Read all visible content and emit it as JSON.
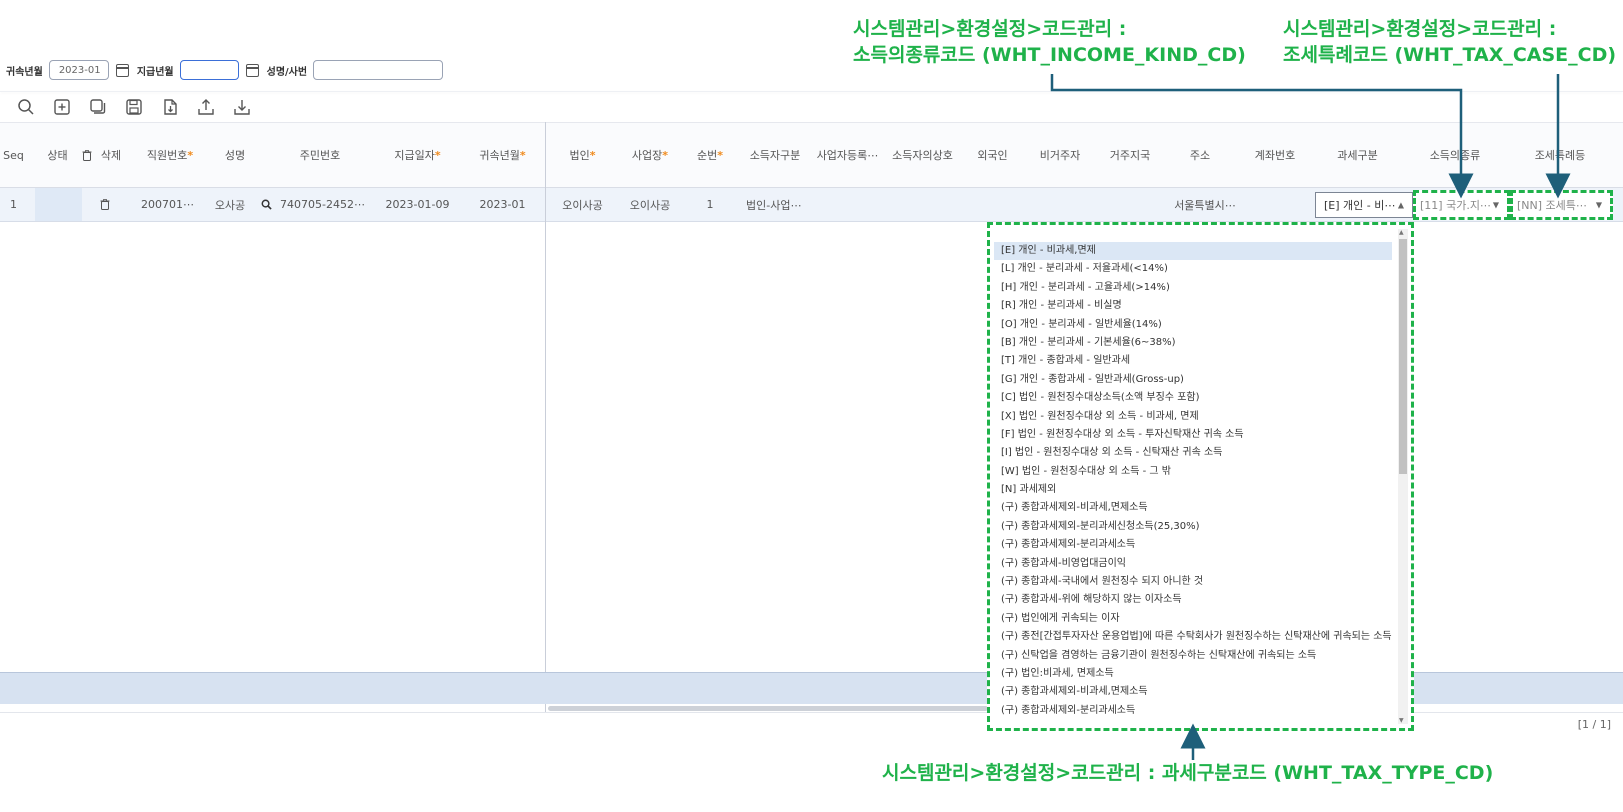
{
  "annotations": {
    "income_kind": {
      "line1": "시스템관리>환경설정>코드관리 :",
      "line2": "소득의종류코드 (WHT_INCOME_KIND_CD)"
    },
    "tax_case": {
      "line1": "시스템관리>환경설정>코드관리 :",
      "line2": "조세특례코드 (WHT_TAX_CASE_CD)"
    },
    "tax_type": {
      "text": "시스템관리>환경설정>코드관리 : 과세구분코드 (WHT_TAX_TYPE_CD)"
    }
  },
  "filters": {
    "belong_label": "귀속년월",
    "belong_value": "2023-01",
    "pay_label": "지급년월",
    "pay_value": "",
    "name_label": "성명/사번",
    "name_value": ""
  },
  "toolbar": [
    "search-icon",
    "add-icon",
    "copy-icon",
    "save-icon",
    "upload-file-icon",
    "upload-icon",
    "download-icon"
  ],
  "columns": {
    "seq": "Seq",
    "status": "상태",
    "delete": "삭제",
    "emp_no": "직원번호",
    "name": "성명",
    "resident_no": "주민번호",
    "pay_date": "지급일자",
    "belong_month": "귀속년월",
    "corp": "법인",
    "biz_place": "사업장",
    "order": "순번",
    "earner_type": "소득자구분",
    "biz_reg_no": "사업자등록⋯",
    "earner_trade_name": "소득자의상호",
    "foreigner": "외국인",
    "non_resident": "비거주자",
    "residence_country": "거주지국",
    "address": "주소",
    "account_no": "계좌번호",
    "tax_type": "과세구분",
    "income_kind": "소득의종류",
    "tax_case": "조세특례등",
    "required_mark": "*"
  },
  "row": {
    "seq": "1",
    "emp_no": "200701⋯",
    "name": "오사공",
    "resident_no": "740705-2452⋯",
    "pay_date": "2023-01-09",
    "belong_month": "2023-01",
    "corp": "오이사공",
    "biz_place": "오이사공",
    "order": "1",
    "earner_type": "법인-사업⋯",
    "address": "서울특별시⋯",
    "tax_type": "[E] 개인 - 비⋯",
    "income_kind": "[11] 국가.지⋯",
    "tax_case": "[NN] 조세특⋯"
  },
  "dropdown_options": [
    "[E] 개인 - 비과세,면제",
    "[L] 개인 - 분리과세 - 저율과세(<14%)",
    "[H] 개인 - 분리과세 - 고율과세(>14%)",
    "[R] 개인 - 분리과세 - 비실명",
    "[O] 개인 - 분리과세 - 일반세율(14%)",
    "[B] 개인 - 분리과세 - 기본세율(6~38%)",
    "[T] 개인 - 종합과세 - 일반과세",
    "[G] 개인 - 종합과세 - 일반과세(Gross-up)",
    "[C] 법인 - 원천징수대상소득(소액 부징수 포함)",
    "[X] 법인 - 원천징수대상 외 소득 - 비과세, 면제",
    "[F] 법인 - 원천징수대상 외 소득 - 투자신탁재산 귀속 소득",
    "[I] 법인 - 원천징수대상 외 소득 - 신탁재산 귀속 소득",
    "[W] 법인 - 원천징수대상 외 소득 - 그 밖",
    "[N] 과세제외",
    "(구) 종합과세제외-비과세,면제소득",
    "(구) 종합과세제외-분리과세신청소득(25,30%)",
    "(구) 종합과세제외-분리과세소득",
    "(구) 종합과세-비영업대금이익",
    "(구) 종합과세-국내에서 원천징수 되지 아니한 것",
    "(구) 종합과세-위에 해당하지 않는 이자소득",
    "(구) 법인에게 귀속되는 이자",
    "(구) 종전[간접투자자산 운용업법]에 따른 수탁회사가 원천징수하는 신탁재산에 귀속되는 소득",
    "(구) 신탁업을 겸영하는 금융기관이 원천징수하는 신탁재산에 귀속되는 소득",
    "(구) 법인:비과세, 면제소득",
    "(구) 종합과세제외-비과세,면제소득",
    "(구) 종합과세제외-분리과세소득"
  ],
  "pagination": "[1 / 1]",
  "colors": {
    "annotation": "#1fb24a",
    "arrow": "#1e5f7a",
    "required": "#f08b1e"
  }
}
